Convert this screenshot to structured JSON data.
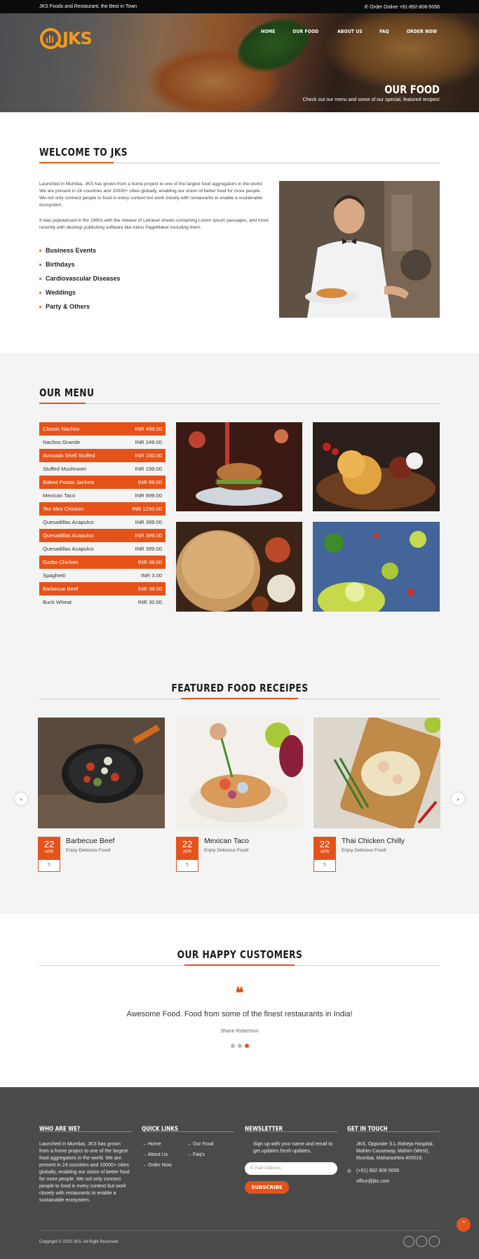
{
  "topbar": {
    "tagline": "JKS Foods and Restaurant, the Best in Town",
    "order": "✆ Order Online +91-892-808-5056"
  },
  "brand": {
    "logo_text": "JKS",
    "accent": "#e5531a",
    "logo_color": "#f59a1e"
  },
  "nav": [
    "HOME",
    "OUR FOOD",
    "ABOUT US",
    "FAQ",
    "ORDER NOW"
  ],
  "hero": {
    "title": "OUR FOOD",
    "subtitle": "Check out our menu and some of our special, featured recipes!"
  },
  "welcome": {
    "title": "WELCOME TO JKS",
    "para1": "Launched in Mumbai, JKS has grown from a home project to one of the largest food aggregators in the world. We are present in 24 countries and 10000+ cities globally, enabling our vision of better food for more people. We not only connect people to food in every context but work closely with restaurants to enable a sustainable ecosystem.",
    "para2": "It was popularised in the 1960s with the release of Letraset sheets containing Lorem Ipsum passages, and more recently with desktop publishing software like Aldus PageMaker including them.",
    "bullets": [
      "Business Events",
      "Birthdays",
      "Cardiovascular Diseases",
      "Weddings",
      "Party & Others"
    ]
  },
  "menu": {
    "title": "OUR MENU",
    "items": [
      {
        "name": "Classic Nachos",
        "price": "INR 499.00"
      },
      {
        "name": "Nachos Grande",
        "price": "INR 249.00"
      },
      {
        "name": "Avocado Shell Stuffed",
        "price": "INR 150.00"
      },
      {
        "name": "Stuffed Mushroom",
        "price": "INR 199.00"
      },
      {
        "name": "Baked Potato Jackets",
        "price": "INR 99.00"
      },
      {
        "name": "Mexican Taco",
        "price": "INR 899.00"
      },
      {
        "name": "Tex-Mex Chicken",
        "price": "INR 1250.00"
      },
      {
        "name": "Quesadillas Acapulco",
        "price": "INR 399.00"
      },
      {
        "name": "Quesadillas Acapulco",
        "price": "INR 399.00"
      },
      {
        "name": "Quesadillas Acapulco",
        "price": "INR 399.00"
      },
      {
        "name": "Garbo Chicken",
        "price": "INR 39.00"
      },
      {
        "name": "Spaghetti",
        "price": "INR 3.00"
      },
      {
        "name": "Barbecue Beef",
        "price": "INR 39.00"
      },
      {
        "name": "Buck Wheat",
        "price": "INR 30.00"
      }
    ]
  },
  "recipes": {
    "title": "FEATURED FOOD RECEIPES",
    "cards": [
      {
        "day": "22",
        "month": "APR",
        "name": "Barbecue Beef",
        "sub": "Enjoy Delicious Food!",
        "count": "5"
      },
      {
        "day": "22",
        "month": "APR",
        "name": "Mexican Taco",
        "sub": "Enjoy Delicious Food!",
        "count": "5"
      },
      {
        "day": "22",
        "month": "APR",
        "name": "Thai Chicken Chilly",
        "sub": "Enjoy Delicious Food!",
        "count": "5"
      }
    ],
    "prev": "‹",
    "next": "›"
  },
  "testimonial": {
    "title": "OUR HAPPY CUSTOMERS",
    "quote_mark": "❝",
    "text": "Awesome Food. Food from some of the finest restaurants in India!",
    "author": "Shane Robertson"
  },
  "footer": {
    "who_title": "WHO ARE WE?",
    "who_text": "Launched in Mumbai, JKS has grown from a home project to one of the largest food aggregators in the world. We are present in 24 countries and 10000+ cities globally, enabling our vision of better food for more people. We not only connect people to food in every context but work closely with restaurants to enable a sustainable ecosystem.",
    "links_title": "QUICK LINKS",
    "links": [
      "Home",
      "Our Food",
      "About Us",
      "Faq's",
      "Order Now"
    ],
    "news_title": "NEWSLETTER",
    "news_text": "Sign up with your name and email to get updates fresh updates.",
    "email_placeholder": "E-mail Address",
    "subscribe": "SUBSCRIBE",
    "touch_title": "GET IN TOUCH",
    "address": "JKS, Opposite S.L.Raheja Hospital, Mahim Causeway, Mahim (West), Mumbai, Maharashtra 400016.",
    "phone": "(+91) 892 808 5056",
    "email": "office@jks.com",
    "copyright": "Copyright © 2020 JKS. All Right Reserved",
    "to_top": "⌃"
  }
}
